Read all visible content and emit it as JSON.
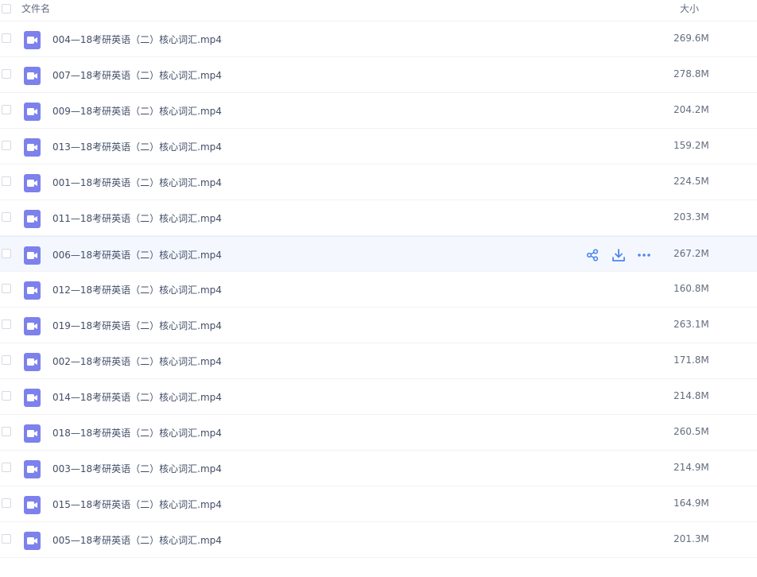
{
  "header": {
    "name_label": "文件名",
    "size_label": "大小"
  },
  "icons": {
    "file_icon": "video-file-icon",
    "share": "share-icon",
    "download": "download-icon",
    "more": "more-icon"
  },
  "colors": {
    "video_icon": "#7d81ec",
    "action_icon": "#4f86f0",
    "hover_row": "#f4f8fe"
  },
  "files": [
    {
      "name": "004—18考研英语（二）核心词汇.mp4",
      "size": "269.6M",
      "hovered": false
    },
    {
      "name": "007—18考研英语（二）核心词汇.mp4",
      "size": "278.8M",
      "hovered": false
    },
    {
      "name": "009—18考研英语（二）核心词汇.mp4",
      "size": "204.2M",
      "hovered": false
    },
    {
      "name": "013—18考研英语（二）核心词汇.mp4",
      "size": "159.2M",
      "hovered": false
    },
    {
      "name": "001—18考研英语（二）核心词汇.mp4",
      "size": "224.5M",
      "hovered": false
    },
    {
      "name": "011—18考研英语（二）核心词汇.mp4",
      "size": "203.3M",
      "hovered": false
    },
    {
      "name": "006—18考研英语（二）核心词汇.mp4",
      "size": "267.2M",
      "hovered": true
    },
    {
      "name": "012—18考研英语（二）核心词汇.mp4",
      "size": "160.8M",
      "hovered": false
    },
    {
      "name": "019—18考研英语（二）核心词汇.mp4",
      "size": "263.1M",
      "hovered": false
    },
    {
      "name": "002—18考研英语（二）核心词汇.mp4",
      "size": "171.8M",
      "hovered": false
    },
    {
      "name": "014—18考研英语（二）核心词汇.mp4",
      "size": "214.8M",
      "hovered": false
    },
    {
      "name": "018—18考研英语（二）核心词汇.mp4",
      "size": "260.5M",
      "hovered": false
    },
    {
      "name": "003—18考研英语（二）核心词汇.mp4",
      "size": "214.9M",
      "hovered": false
    },
    {
      "name": "015—18考研英语（二）核心词汇.mp4",
      "size": "164.9M",
      "hovered": false
    },
    {
      "name": "005—18考研英语（二）核心词汇.mp4",
      "size": "201.3M",
      "hovered": false
    }
  ]
}
